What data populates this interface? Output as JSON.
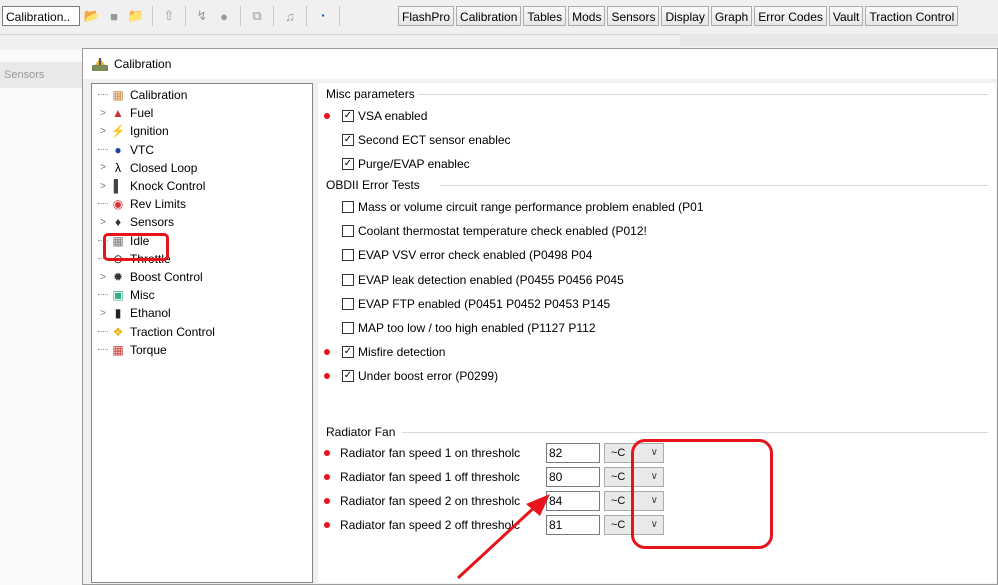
{
  "toolbar": {
    "combo_value": "Calibration..",
    "menu_buttons": [
      "FlashPro",
      "Calibration",
      "Tables",
      "Mods",
      "Sensors",
      "Display",
      "Graph",
      "Error Codes",
      "Vault",
      "Traction Control"
    ]
  },
  "background": {
    "left_header": "Sensors"
  },
  "dialog": {
    "title": "Calibration",
    "tree": [
      {
        "label": "Calibration",
        "icon": "calibration-icon",
        "expander": false
      },
      {
        "label": "Fuel",
        "icon": "fuel-icon",
        "expander": true
      },
      {
        "label": "Ignition",
        "icon": "ignition-icon",
        "expander": true
      },
      {
        "label": "VTC",
        "icon": "vtc-icon",
        "expander": false
      },
      {
        "label": "Closed Loop",
        "icon": "lambda-icon",
        "expander": true
      },
      {
        "label": "Knock Control",
        "icon": "knock-icon",
        "expander": true
      },
      {
        "label": "Rev Limits",
        "icon": "rev-limits-icon",
        "expander": false
      },
      {
        "label": "Sensors",
        "icon": "sensors-icon",
        "expander": true
      },
      {
        "label": "Idle",
        "icon": "idle-icon",
        "expander": false
      },
      {
        "label": "Throttle",
        "icon": "throttle-icon",
        "expander": false
      },
      {
        "label": "Boost Control",
        "icon": "boost-icon",
        "expander": true
      },
      {
        "label": "Misc",
        "icon": "misc-icon",
        "expander": false,
        "selected": true
      },
      {
        "label": "Ethanol",
        "icon": "ethanol-icon",
        "expander": true
      },
      {
        "label": "Traction Control",
        "icon": "traction-icon",
        "expander": false
      },
      {
        "label": "Torque",
        "icon": "torque-icon",
        "expander": false
      }
    ],
    "misc": {
      "group_title": "Misc parameters",
      "items": [
        {
          "label": "VSA enabled",
          "checked": true,
          "dot": true
        },
        {
          "label": "Second ECT sensor enablec",
          "checked": true,
          "dot": false
        },
        {
          "label": "Purge/EVAP enablec",
          "checked": true,
          "dot": false
        }
      ]
    },
    "obd": {
      "group_title": "OBDII Error Tests",
      "items": [
        {
          "label": "Mass or volume circuit range performance problem enabled (P01",
          "checked": false,
          "dot": false
        },
        {
          "label": "Coolant thermostat temperature check enabled (P012!",
          "checked": false,
          "dot": false
        },
        {
          "label": "EVAP VSV error check enabled (P0498 P04",
          "checked": false,
          "dot": false
        },
        {
          "label": "EVAP leak detection enabled (P0455 P0456 P045",
          "checked": false,
          "dot": false
        },
        {
          "label": "EVAP FTP enabled (P0451 P0452 P0453 P145",
          "checked": false,
          "dot": false
        },
        {
          "label": "MAP too low / too high enabled (P1127 P112",
          "checked": false,
          "dot": false
        },
        {
          "label": "Misfire detection",
          "checked": true,
          "dot": true
        },
        {
          "label": "Under boost error (P0299)",
          "checked": true,
          "dot": true
        }
      ]
    },
    "fan": {
      "group_title": "Radiator Fan",
      "items": [
        {
          "label": "Radiator fan speed 1 on thresholc",
          "value": "82",
          "unit": "~C"
        },
        {
          "label": "Radiator fan speed 1 off thresholc",
          "value": "80",
          "unit": "~C"
        },
        {
          "label": "Radiator fan speed 2 on thresholc",
          "value": "84",
          "unit": "~C"
        },
        {
          "label": "Radiator fan speed 2 off thresholc",
          "value": "81",
          "unit": "~C"
        }
      ]
    }
  },
  "colors": {
    "highlight": "#e8141c"
  }
}
